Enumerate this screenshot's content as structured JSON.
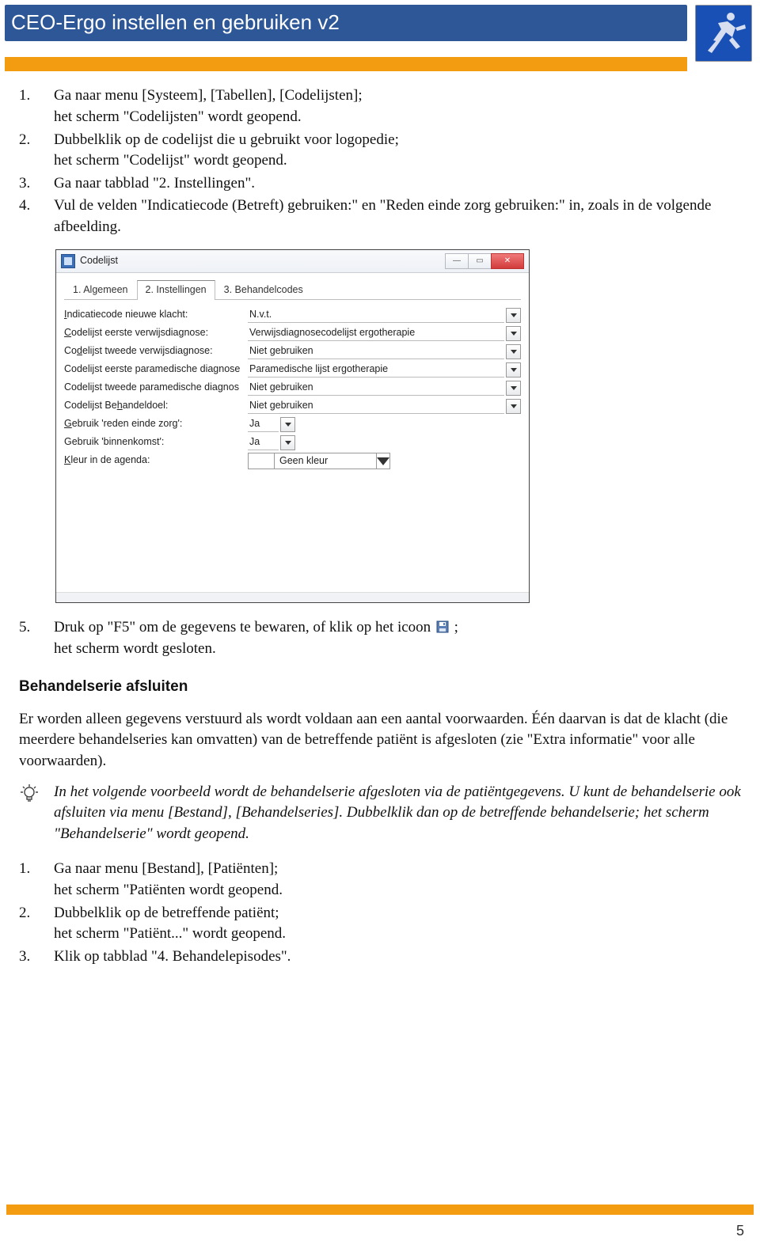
{
  "header": {
    "title": "CEO-Ergo instellen en gebruiken v2"
  },
  "stepsA": [
    {
      "num": "1.",
      "text": "Ga naar menu [Systeem], [Tabellen], [Codelijsten];\nhet scherm \"Codelijsten\" wordt geopend."
    },
    {
      "num": "2.",
      "text": "Dubbelklik op de codelijst die u gebruikt voor logopedie;\nhet scherm \"Codelijst\" wordt geopend."
    },
    {
      "num": "3.",
      "text": "Ga naar tabblad \"2. Instellingen\"."
    },
    {
      "num": "4.",
      "text": "Vul de velden \"Indicatiecode (Betreft) gebruiken:\" en \"Reden einde zorg gebruiken:\" in, zoals in de volgende afbeelding."
    }
  ],
  "screenshot": {
    "windowTitle": "Codelijst",
    "tabs": [
      "1. Algemeen",
      "2. Instellingen",
      "3. Behandelcodes"
    ],
    "activeTab": 1,
    "rows": [
      {
        "label_html": "<u>I</u>ndicatiecode nieuwe klacht:",
        "value": "N.v.t.",
        "drop": true
      },
      {
        "label_html": "<u>C</u>odelijst eerste verwijsdiagnose:",
        "value": "Verwijsdiagnosecodelijst ergotherapie",
        "drop": true
      },
      {
        "label_html": "Co<u>d</u>elijst tweede verwijsdiagnose:",
        "value": "Niet gebruiken",
        "drop": true
      },
      {
        "label_html": "Codelijst eerste paramedische diagnose",
        "value": "Paramedische lijst ergotherapie",
        "drop": true
      },
      {
        "label_html": "Codelijst tweede paramedische diagnos",
        "value": "Niet gebruiken",
        "drop": true
      },
      {
        "label_html": "Codelijst Be<u>h</u>andeldoel:",
        "value": "Niet gebruiken",
        "drop": true
      },
      {
        "label_html": "<u>G</u>ebruik 'reden einde zorg':",
        "value": "Ja",
        "drop": true,
        "short": true
      },
      {
        "label_html": "Gebruik 'binnenkomst':",
        "value": "Ja",
        "drop": true,
        "short": true
      }
    ],
    "colorRow": {
      "label_html": "<u>K</u>leur in de agenda:",
      "value": "Geen kleur"
    }
  },
  "step5": {
    "num": "5.",
    "part1": "Druk op \"F5\" om de gegevens te bewaren, of klik op het icoon",
    "part2": ";",
    "line2": "het scherm wordt gesloten."
  },
  "sectionTitle": "Behandelserie afsluiten",
  "para1": "Er worden alleen gegevens verstuurd als wordt voldaan aan een aantal voorwaarden. Één daarvan is dat de klacht (die meerdere behandelseries kan omvatten) van de betreffende patiënt is afgesloten (zie \"Extra informatie\" voor alle voorwaarden).",
  "tip": "In het volgende voorbeeld wordt de behandelserie afgesloten via de patiëntgegevens. U kunt de behandelserie ook afsluiten via menu [Bestand], [Behandelseries]. Dubbelklik dan op de betreffende behandelserie; het scherm \"Behandelserie\" wordt geopend.",
  "stepsB": [
    {
      "num": "1.",
      "text": "Ga naar menu [Bestand], [Patiënten];\nhet scherm \"Patiënten wordt geopend."
    },
    {
      "num": "2.",
      "text": "Dubbelklik op de betreffende patiënt;\nhet scherm \"Patiënt...\" wordt geopend."
    },
    {
      "num": "3.",
      "text": "Klik op tabblad \"4. Behandelepisodes\"."
    }
  ],
  "pageNumber": "5"
}
